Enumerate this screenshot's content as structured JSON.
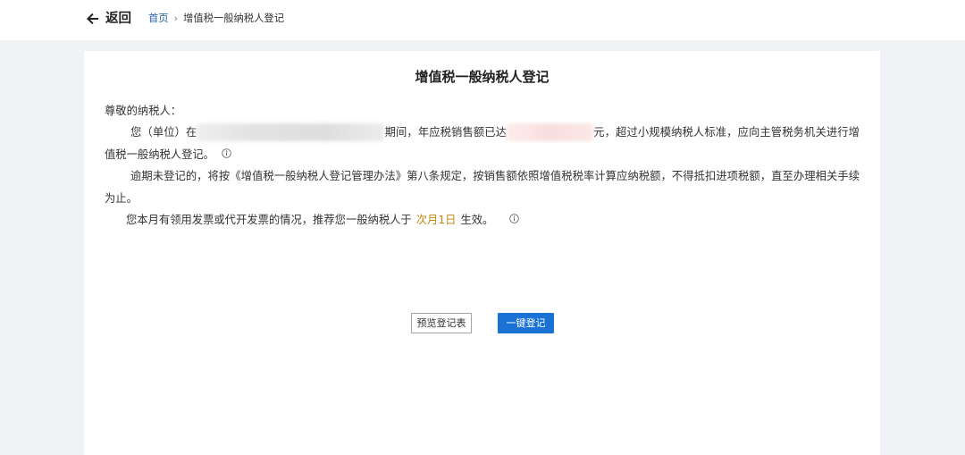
{
  "colors": {
    "accent": "#1a73d4",
    "link": "#2563a8",
    "highlight": "#c5850c",
    "text": "#333333",
    "page_bg": "#f0f2f5"
  },
  "topbar": {
    "back_icon": "arrow-left-icon",
    "back_label": "返回",
    "breadcrumb": {
      "home": "首页",
      "separator": "›",
      "current": "增值税一般纳税人登记"
    }
  },
  "card": {
    "title": "增值税一般纳税人登记",
    "greeting": "尊敬的纳税人：",
    "para1": {
      "line1_part1": "您（单位）在",
      "line1_part2": "期间，年应税销售额已达",
      "line1_part3": "元，超过小规模纳税人标准，应向主管税务机关进行增",
      "line2": "值税一般纳税人登记。"
    },
    "para2": {
      "line1": "逾期未登记的，将按《增值税一般纳税人登记管理办法》第八条规定，按销售额依照增值税税率计算应纳税额，不得抵扣进项税额，直至办理相关手续",
      "line2": "为止。"
    },
    "para3": {
      "before": "您本月有领用发票或代开发票的情况，推荐您一般纳税人于",
      "highlight": "次月1日",
      "after": "生效。"
    },
    "info_icon": "info-icon"
  },
  "actions": {
    "preview_label": "预览登记表",
    "register_label": "一键登记"
  }
}
